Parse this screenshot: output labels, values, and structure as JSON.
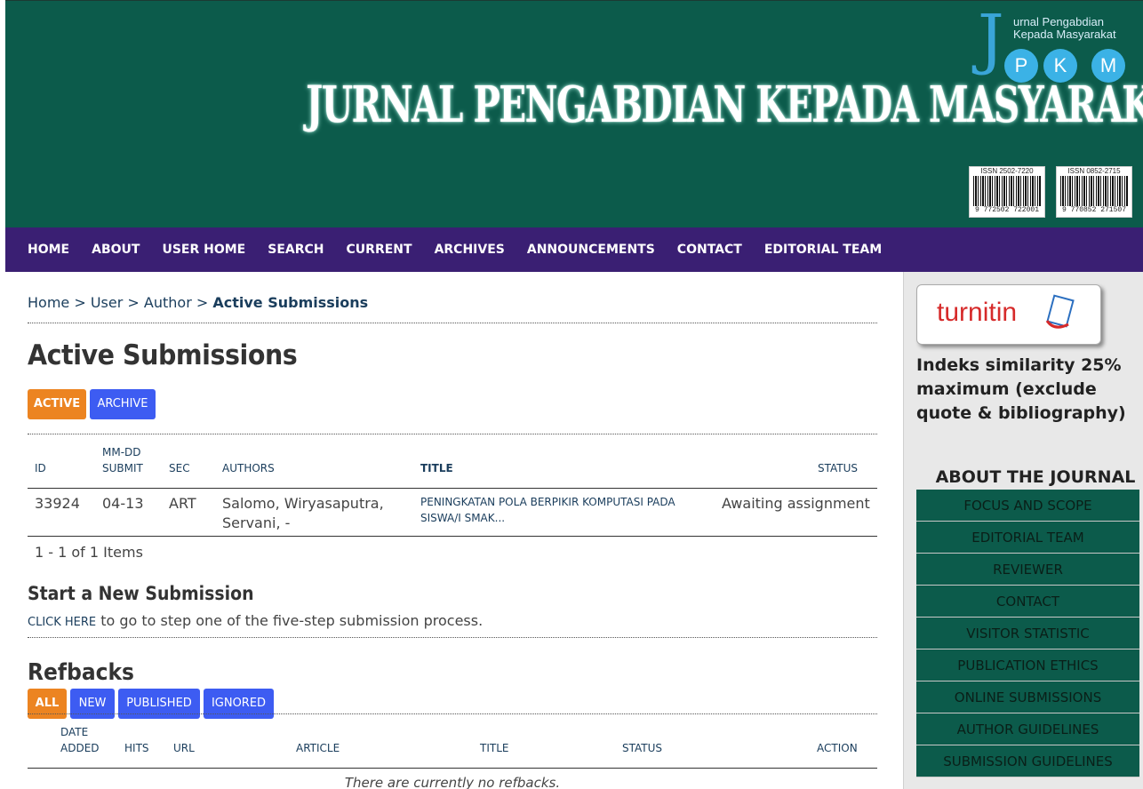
{
  "header": {
    "title": "JURNAL PENGABDIAN KEPADA MASYARAKAT",
    "logo_line1": "urnal Pengabdian",
    "logo_line2": "Kepada Masyarakat",
    "logo_letters": [
      "P",
      "K",
      "M"
    ],
    "barcodes": [
      {
        "issn": "ISSN 2502-7220",
        "number": "9 772502 722001"
      },
      {
        "issn": "ISSN 0852-2715",
        "number": "9 770852 271507"
      }
    ]
  },
  "nav": [
    "HOME",
    "ABOUT",
    "USER HOME",
    "SEARCH",
    "CURRENT",
    "ARCHIVES",
    "ANNOUNCEMENTS",
    "CONTACT",
    "EDITORIAL TEAM"
  ],
  "breadcrumb": {
    "home": "Home",
    "user": "User",
    "author": "Author",
    "sep": ">",
    "current": "Active Submissions"
  },
  "page_title": "Active Submissions",
  "tabs": {
    "active": "ACTIVE",
    "archive": "ARCHIVE"
  },
  "submissions_table": {
    "headers": {
      "id": "ID",
      "date_line1": "MM-DD",
      "date_line2": "SUBMIT",
      "sec": "SEC",
      "authors": "AUTHORS",
      "title": "TITLE",
      "status": "STATUS"
    },
    "rows": [
      {
        "id": "33924",
        "date": "04-13",
        "sec": "ART",
        "authors": "Salomo, Wiryasaputra, Servani, -",
        "title": "PENINGKATAN POLA BERPIKIR KOMPUTASI PADA SISWA/I SMAK...",
        "status": "Awaiting assignment"
      }
    ],
    "pagination": "1 - 1 of 1 Items"
  },
  "new_submission": {
    "heading": "Start a New Submission",
    "link": "CLICK HERE",
    "text": " to go to step one of the five-step submission process."
  },
  "refbacks": {
    "heading": "Refbacks",
    "filters": {
      "all": "ALL",
      "new": "NEW",
      "published": "PUBLISHED",
      "ignored": "IGNORED"
    },
    "headers": {
      "date_line1": "DATE",
      "date_line2": "ADDED",
      "hits": "HITS",
      "url": "URL",
      "article": "ARTICLE",
      "title": "TITLE",
      "status": "STATUS",
      "action": "ACTION"
    },
    "empty": "There are currently no refbacks."
  },
  "sidebar": {
    "turnitin": "turnitin",
    "similarity": "Indeks similarity 25% maximum (exclude quote & bibliography)",
    "about_heading": "ABOUT THE JOURNAL",
    "menu": [
      "FOCUS AND SCOPE",
      "EDITORIAL TEAM",
      "REVIEWER",
      "CONTACT",
      "VISITOR STATISTIC",
      "PUBLICATION ETHICS",
      "ONLINE SUBMISSIONS",
      "AUTHOR GUIDELINES",
      "SUBMISSION GUIDELINES"
    ]
  },
  "colors": {
    "header_bg": "#0c5b4b",
    "nav_bg": "#3a1f73",
    "active_tab": "#ec8421",
    "inactive_tab": "#3d5cf2",
    "sidebar_menu_bg": "#0c5b4b"
  }
}
